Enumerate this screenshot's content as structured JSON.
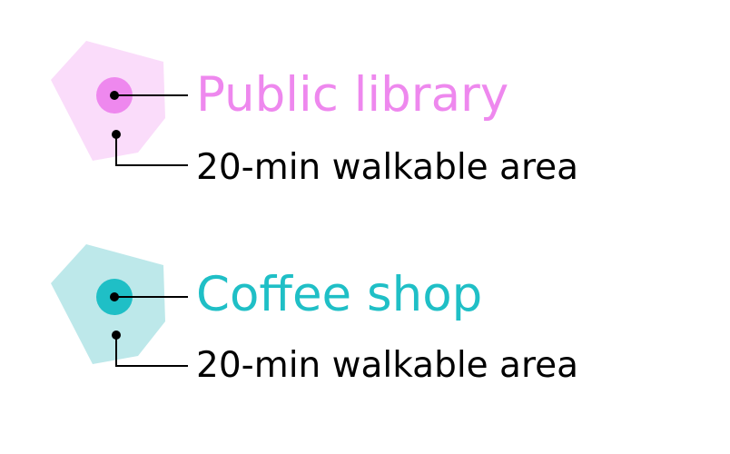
{
  "legend": {
    "items": [
      {
        "name": "Public library",
        "area_label": "20-min walkable area",
        "color": "#ee88ee",
        "area_color": "#fadcfa",
        "icon": "poi-marker-icon"
      },
      {
        "name": "Coffee shop",
        "area_color": "#bde8ea",
        "area_label": "20-min walkable area",
        "color": "#1fbfc6",
        "icon": "poi-marker-icon"
      }
    ],
    "line_color": "#000000"
  }
}
